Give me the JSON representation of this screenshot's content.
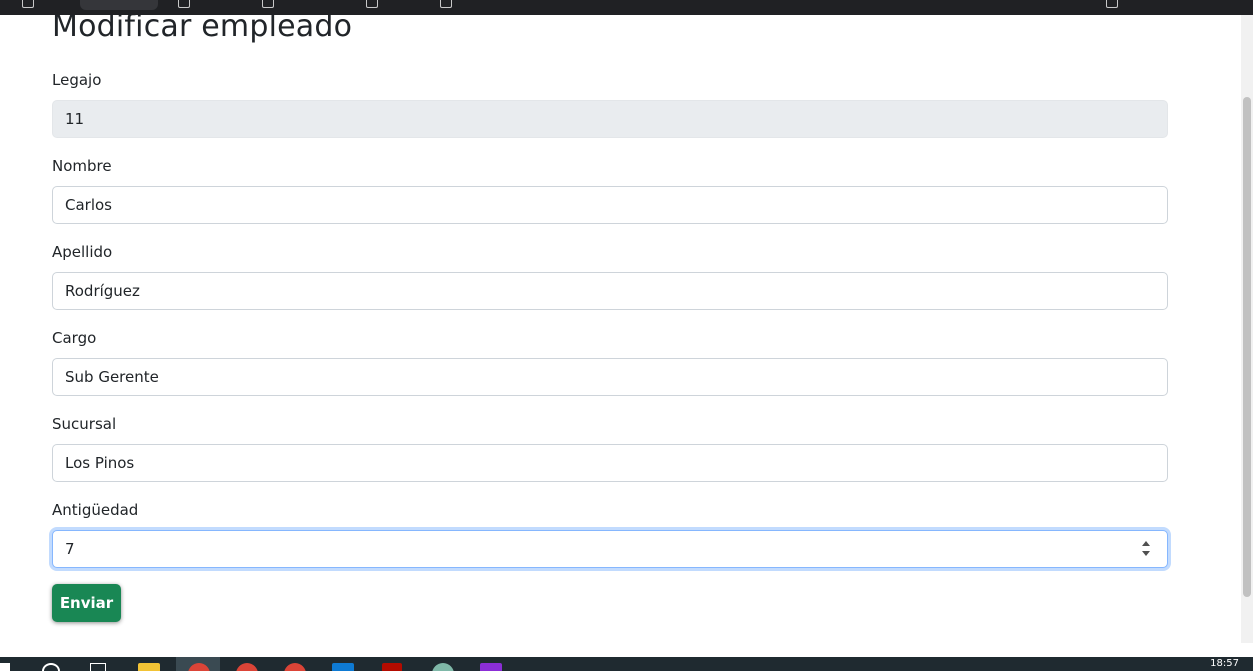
{
  "page": {
    "title": "Modificar empleado"
  },
  "form": {
    "fields": [
      {
        "label": "Legajo",
        "value": "11",
        "disabled": true
      },
      {
        "label": "Nombre",
        "value": "Carlos"
      },
      {
        "label": "Apellido",
        "value": "Rodríguez"
      },
      {
        "label": "Cargo",
        "value": "Sub Gerente"
      },
      {
        "label": "Sucursal",
        "value": "Los Pinos"
      },
      {
        "label": "Antigüedad",
        "value": "7",
        "type": "number",
        "focused": true
      }
    ],
    "submit_label": "Enviar"
  },
  "colors": {
    "submit_button": "#198754",
    "focus_border": "#86b7fe",
    "disabled_input": "#e9ecef"
  },
  "taskbar": {
    "clock": "18:57",
    "icons": [
      "windows-start-icon",
      "search-icon",
      "task-view-icon",
      "file-explorer-icon",
      "chrome-icon",
      "chrome-icon",
      "chrome-icon",
      "vscode-icon",
      "acrobat-icon",
      "app-icon",
      "intellij-icon"
    ]
  }
}
